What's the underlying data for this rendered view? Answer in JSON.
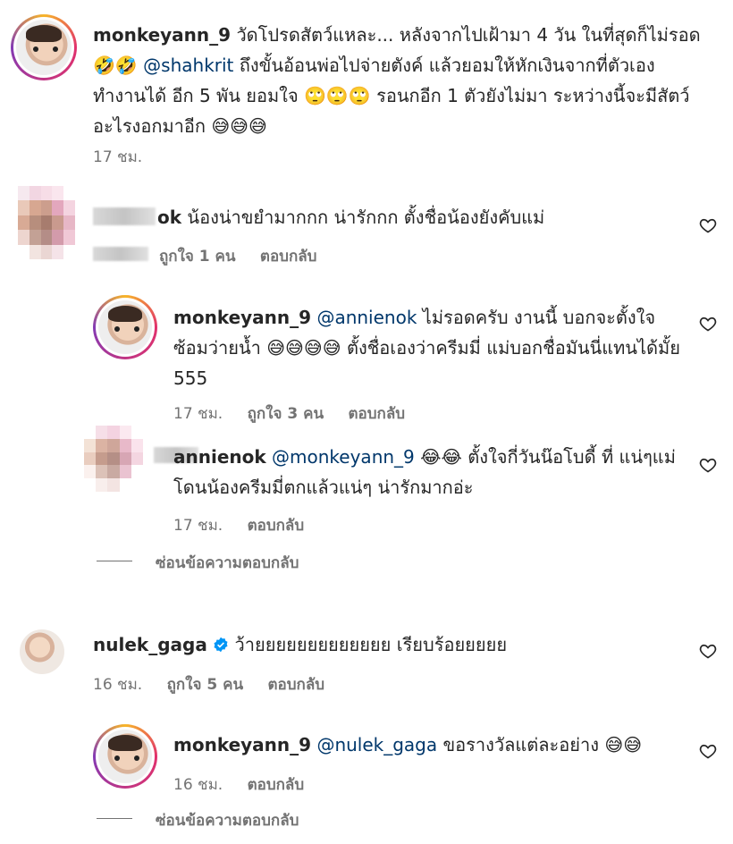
{
  "comments": [
    {
      "username": "monkeyann_9",
      "text_pre": "วัดโปรดสัตว์แหละ... หลังจากไปเฝ้ามา 4 วัน ในที่สุดก็ไม่รอด 🤣🤣",
      "mention": "@shahkrit",
      "text_post": "ถึงขั้นอ้อนพ่อไปจ่ายตังค์ แล้วยอมให้หักเงินจากที่ตัวเองทำงานได้ อีก 5 พัน ยอมใจ 🙄🙄🙄 รอนกอีก 1 ตัวยังไม่มา ระหว่างนี้จะมีสัตว์อะไรงอกมาอีก 😅😅😅",
      "time": "17 ชม."
    },
    {
      "username_partial": "ok",
      "text": "น้องน่าขยำมากกก น่ารักกก ตั้งชื่อน้องยังคับแม่",
      "likes": "ถูกใจ 1 คน",
      "reply": "ตอบกลับ"
    },
    {
      "username": "monkeyann_9",
      "mention": "@annienok",
      "text": "ไม่รอดครับ งานนี้ บอกจะตั้งใจซ้อมว่ายน้ำ 😅😅😅😅 ตั้งชื่อเองว่าครีมมี่ แม่บอกชื่อมันนี่แทนได้มั้ย 555",
      "time": "17 ชม.",
      "likes": "ถูกใจ 3 คน",
      "reply": "ตอบกลับ"
    },
    {
      "username_partial": "annienok",
      "mention": "@monkeyann_9",
      "text_pre": "😂😂 ตั้งใจกี่วันน๊อโบดี้ ที่",
      "text_post": "แน่ๆแม่โดนน้องครีมมี่ตกแล้วแน่ๆ น่ารักมากอ่ะ",
      "time": "17 ชม.",
      "reply": "ตอบกลับ"
    },
    {
      "hide_replies": "ซ่อนข้อความตอบกลับ"
    },
    {
      "username": "nulek_gaga",
      "text": "ว้ายยยยยยยยยยยยย เรียบร้อยยยยย",
      "time": "16 ชม.",
      "likes": "ถูกใจ 5 คน",
      "reply": "ตอบกลับ"
    },
    {
      "username": "monkeyann_9",
      "mention": "@nulek_gaga",
      "text": "ขอรางวัลแต่ละอย่าง 😅😅",
      "time": "16 ชม.",
      "reply": "ตอบกลับ"
    },
    {
      "hide_replies": "ซ่อนข้อความตอบกลับ"
    }
  ],
  "colors": {
    "mention": "#00376b",
    "meta": "#737373",
    "verified": "#0095f6"
  },
  "icons": [
    "heart-icon",
    "verified-badge-icon"
  ]
}
